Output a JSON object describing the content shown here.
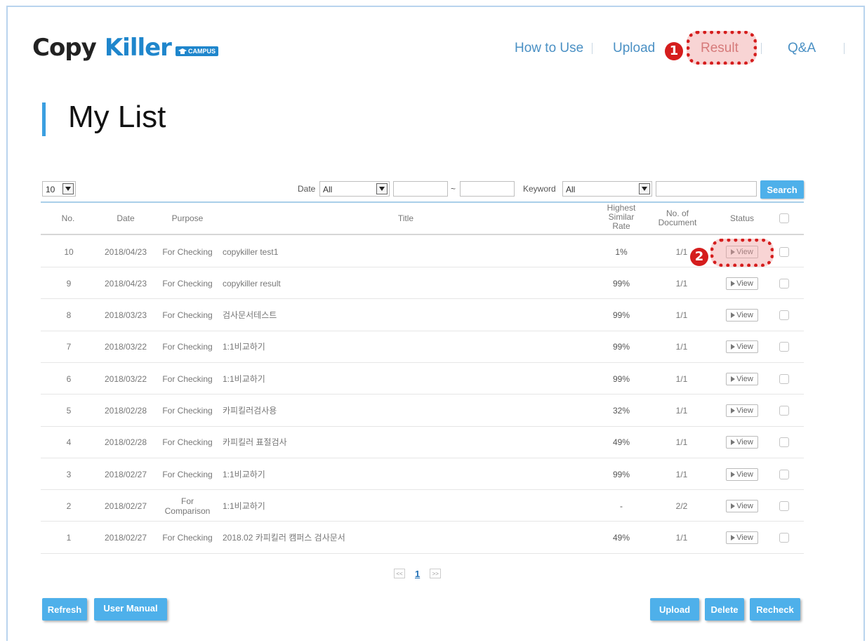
{
  "header": {
    "logo_copy": "Copy",
    "logo_killer": "Killer",
    "logo_campus": "CAMPUS",
    "nav": [
      {
        "label": "How to Use"
      },
      {
        "label": "Upload"
      },
      {
        "label": "Result"
      },
      {
        "label": "Q&A"
      }
    ],
    "marker_1": "1",
    "marker_2": "2"
  },
  "page_title": "My List",
  "filters": {
    "page_size": "10",
    "date_label": "Date",
    "date_option": "All",
    "date_from": "",
    "date_sep": "~",
    "date_to": "",
    "keyword_label": "Keyword",
    "keyword_option": "All",
    "keyword_value": "",
    "search_label": "Search"
  },
  "table": {
    "headers": {
      "no": "No.",
      "date": "Date",
      "purpose": "Purpose",
      "title": "Title",
      "rate": "Highest Similar Rate",
      "docs": "No. of Document",
      "status": "Status"
    },
    "view_label": "View",
    "rows": [
      {
        "no": "10",
        "date": "2018/04/23",
        "purpose": "For Checking",
        "title": "copykiller test1",
        "rate": "1%",
        "docs": "1/1"
      },
      {
        "no": "9",
        "date": "2018/04/23",
        "purpose": "For Checking",
        "title": "copykiller result",
        "rate": "99%",
        "docs": "1/1"
      },
      {
        "no": "8",
        "date": "2018/03/23",
        "purpose": "For Checking",
        "title": "검사문서테스트",
        "rate": "99%",
        "docs": "1/1"
      },
      {
        "no": "7",
        "date": "2018/03/22",
        "purpose": "For Checking",
        "title": "1:1비교하기",
        "rate": "99%",
        "docs": "1/1"
      },
      {
        "no": "6",
        "date": "2018/03/22",
        "purpose": "For Checking",
        "title": "1:1비교하기",
        "rate": "99%",
        "docs": "1/1"
      },
      {
        "no": "5",
        "date": "2018/02/28",
        "purpose": "For Checking",
        "title": "카피킬러검사용",
        "rate": "32%",
        "docs": "1/1"
      },
      {
        "no": "4",
        "date": "2018/02/28",
        "purpose": "For Checking",
        "title": "카피킬러 표절검사",
        "rate": "49%",
        "docs": "1/1"
      },
      {
        "no": "3",
        "date": "2018/02/27",
        "purpose": "For Checking",
        "title": "1:1비교하기",
        "rate": "99%",
        "docs": "1/1"
      },
      {
        "no": "2",
        "date": "2018/02/27",
        "purpose": "For Comparison",
        "title": "1:1비교하기",
        "rate": "-",
        "docs": "2/2"
      },
      {
        "no": "1",
        "date": "2018/02/27",
        "purpose": "For Checking",
        "title": "2018.02 카피킬러 캠퍼스 검사문서",
        "rate": "49%",
        "docs": "1/1"
      }
    ]
  },
  "pagination": {
    "prev": "<<",
    "current": "1",
    "next": ">>"
  },
  "buttons": {
    "refresh": "Refresh",
    "manual": "User Manual",
    "upload": "Upload",
    "delete": "Delete",
    "recheck": "Recheck"
  },
  "colors": {
    "accent": "#4eb0ea",
    "brand_blue": "#1f86cc",
    "highlight_red": "#d51d1d"
  }
}
